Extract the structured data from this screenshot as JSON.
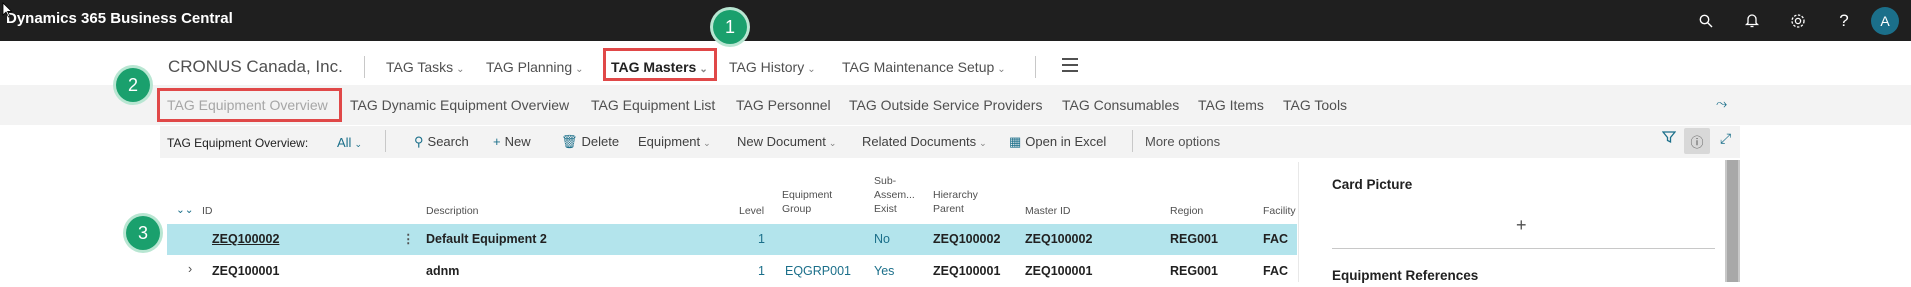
{
  "app": {
    "title": "Dynamics 365 Business Central"
  },
  "top_icons": [
    "search-icon",
    "bell-icon",
    "gear-icon",
    "help-icon"
  ],
  "user": {
    "initial": "A"
  },
  "nav": {
    "company": "CRONUS Canada, Inc.",
    "items": [
      {
        "label": "TAG Tasks"
      },
      {
        "label": "TAG Planning"
      },
      {
        "label": "TAG Masters"
      },
      {
        "label": "TAG History"
      },
      {
        "label": "TAG Maintenance Setup"
      }
    ]
  },
  "subnav": {
    "items": [
      {
        "label": "TAG Equipment Overview"
      },
      {
        "label": "TAG Dynamic Equipment Overview"
      },
      {
        "label": "TAG Equipment List"
      },
      {
        "label": "TAG Personnel"
      },
      {
        "label": "TAG Outside Service Providers"
      },
      {
        "label": "TAG Consumables"
      },
      {
        "label": "TAG Items"
      },
      {
        "label": "TAG Tools"
      }
    ]
  },
  "actions": {
    "view_label": "TAG Equipment Overview:",
    "view_value": "All",
    "search": "Search",
    "new": "New",
    "delete": "Delete",
    "equipment": "Equipment",
    "new_document": "New Document",
    "related_documents": "Related Documents",
    "open_excel": "Open in Excel",
    "more_options": "More options"
  },
  "table": {
    "headers": {
      "id": "ID",
      "description": "Description",
      "level": "Level",
      "equipment_group_1": "Equipment",
      "equipment_group_2": "Group",
      "sub_1": "Sub-",
      "sub_2": "Assem...",
      "sub_3": "Exist",
      "hierarchy_1": "Hierarchy",
      "hierarchy_2": "Parent",
      "master_id": "Master ID",
      "region": "Region",
      "facility": "Facility"
    },
    "rows": [
      {
        "id": "ZEQ100002",
        "description": "Default Equipment 2",
        "level": "1",
        "group": "",
        "sub_exist": "No",
        "hierarchy_parent": "ZEQ100002",
        "master_id": "ZEQ100002",
        "region": "REG001",
        "facility": "FAC"
      },
      {
        "id": "ZEQ100001",
        "description": "adnm",
        "level": "1",
        "group": "EQGRP001",
        "sub_exist": "Yes",
        "hierarchy_parent": "ZEQ100001",
        "master_id": "ZEQ100001",
        "region": "REG001",
        "facility": "FAC"
      }
    ]
  },
  "factbox": {
    "card_picture": "Card Picture",
    "equipment_references": "Equipment References"
  },
  "annotations": {
    "one": "1",
    "two": "2",
    "three": "3"
  },
  "colors": {
    "topbar": "#1f1f1f",
    "accent": "#1b6f8a",
    "selected_row": "#b3e4ec",
    "badge": "#1aa06d",
    "highlight": "#e04848"
  }
}
